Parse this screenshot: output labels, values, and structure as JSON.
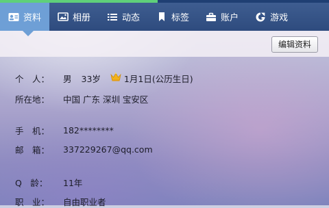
{
  "progress": {
    "fraction": 0.48
  },
  "tabs": [
    {
      "label": "资料",
      "icon": "id-card-icon",
      "active": true
    },
    {
      "label": "相册",
      "icon": "photo-album-icon",
      "active": false
    },
    {
      "label": "动态",
      "icon": "list-icon",
      "active": false
    },
    {
      "label": "标签",
      "icon": "bookmark-icon",
      "active": false
    },
    {
      "label": "账户",
      "icon": "briefcase-icon",
      "active": false
    },
    {
      "label": "游戏",
      "icon": "game-icon",
      "active": false
    }
  ],
  "toolbar": {
    "edit_label": "编辑资料"
  },
  "profile": {
    "personal": {
      "label": "个　人：",
      "gender": "男",
      "age": "33岁",
      "birthday": "1月1日(公历生日)",
      "birthday_icon": "crown-icon"
    },
    "location": {
      "label": "所在地：",
      "value": "中国 广东 深圳 宝安区"
    },
    "phone": {
      "label": "手　机：",
      "value": "182********"
    },
    "email": {
      "label": "邮　箱：",
      "value": "337229267@qq.com"
    },
    "qage": {
      "label": "Q　龄：",
      "value": "11年"
    },
    "job": {
      "label": "职　业：",
      "value": "自由职业者"
    }
  },
  "colors": {
    "tabbar": "#34538a",
    "active_tab": "#6e9fd6",
    "progress": "#5fd07a",
    "crown": "#f2b21c"
  }
}
